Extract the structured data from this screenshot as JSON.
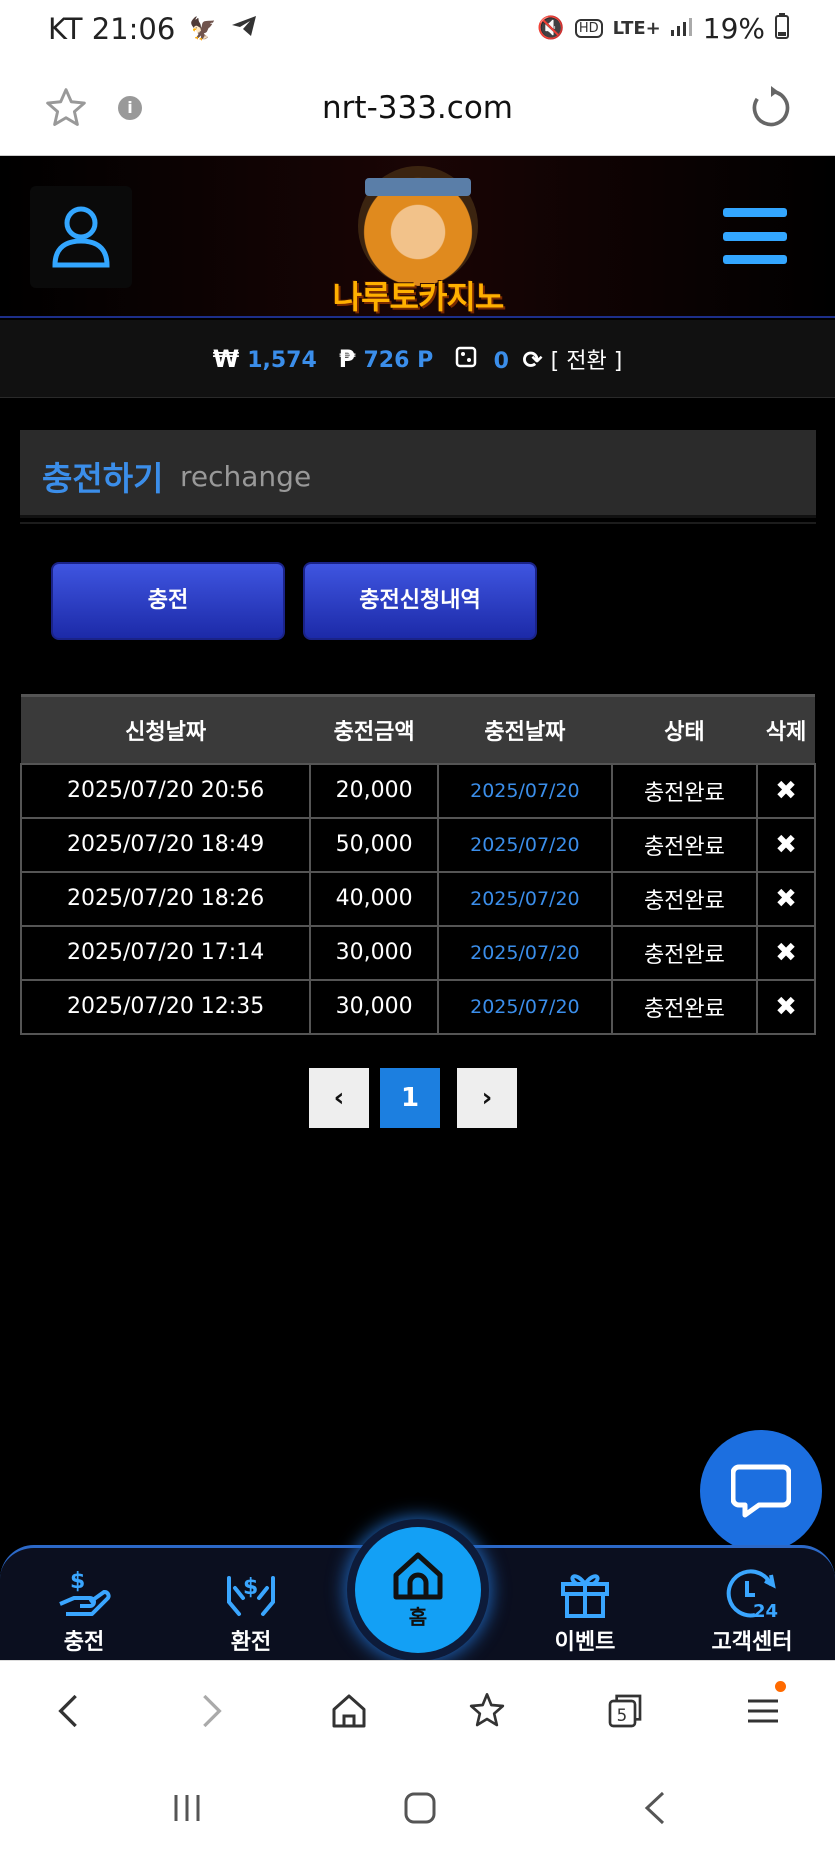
{
  "status_bar": {
    "carrier_time": "KT 21:06",
    "battery": "19%",
    "network": "LTE+"
  },
  "browser": {
    "url": "nrt-333.com"
  },
  "header": {
    "logo_text": "나루토카지노"
  },
  "balance": {
    "won_symbol": "₩",
    "won_value": "1,574",
    "point_symbol": "₱",
    "point_value": "726 P",
    "ticket_value": "0",
    "convert_label": "[ 전환 ]"
  },
  "section": {
    "title_ko": "충전하기",
    "title_en": "rechange"
  },
  "tabs": {
    "charge": "충전",
    "history": "충전신청내역"
  },
  "table": {
    "headers": {
      "request_date": "신청날짜",
      "amount": "충전금액",
      "charge_date": "충전날짜",
      "status": "상태",
      "delete": "삭제"
    },
    "rows": [
      {
        "request_date": "2025/07/20 20:56",
        "amount": "20,000",
        "charge_date": "2025/07/20",
        "status": "충전완료",
        "delete": "✖"
      },
      {
        "request_date": "2025/07/20 18:49",
        "amount": "50,000",
        "charge_date": "2025/07/20",
        "status": "충전완료",
        "delete": "✖"
      },
      {
        "request_date": "2025/07/20 18:26",
        "amount": "40,000",
        "charge_date": "2025/07/20",
        "status": "충전완료",
        "delete": "✖"
      },
      {
        "request_date": "2025/07/20 17:14",
        "amount": "30,000",
        "charge_date": "2025/07/20",
        "status": "충전완료",
        "delete": "✖"
      },
      {
        "request_date": "2025/07/20 12:35",
        "amount": "30,000",
        "charge_date": "2025/07/20",
        "status": "충전완료",
        "delete": "✖"
      }
    ]
  },
  "pagination": {
    "prev": "‹",
    "current": "1",
    "next": "›"
  },
  "bottom_nav": {
    "charge": "충전",
    "exchange": "환전",
    "home": "홈",
    "event": "이벤트",
    "support": "고객센터"
  },
  "system_nav": {
    "tab_count": "5"
  },
  "colors": {
    "accent_blue": "#3b8eea",
    "button_blue": "#2a3ecf",
    "home_blue": "#13a0f5",
    "chat_blue": "#1c6fe0"
  }
}
